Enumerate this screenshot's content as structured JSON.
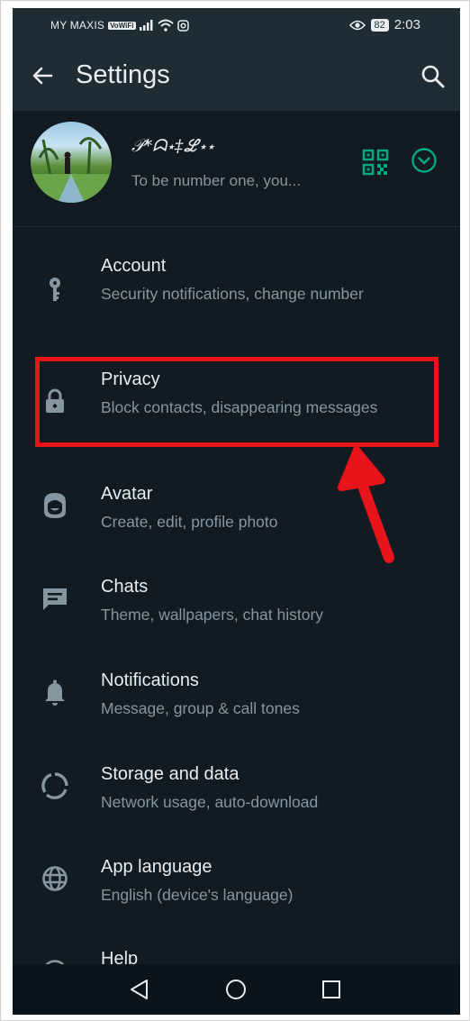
{
  "status_bar": {
    "carrier": "MY MAXIS",
    "wifi_badge": "VoWiFi",
    "battery": "82",
    "time": "2:03"
  },
  "app_bar": {
    "title": "Settings",
    "back_icon": "arrow-left-icon",
    "search_icon": "search-icon"
  },
  "profile": {
    "name": "𝒫*ᗣ⋆‡ℒ⋆⋆",
    "about": "To be number one, you...",
    "qr_icon": "qr-code-icon",
    "expand_icon": "chevron-down-circle-icon"
  },
  "settings": [
    {
      "label": "Account",
      "subtitle": "Security notifications, change number",
      "icon": "key-icon"
    },
    {
      "label": "Privacy",
      "subtitle": "Block contacts, disappearing messages",
      "icon": "lock-icon"
    },
    {
      "label": "Avatar",
      "subtitle": "Create, edit, profile photo",
      "icon": "avatar-face-icon"
    },
    {
      "label": "Chats",
      "subtitle": "Theme, wallpapers, chat history",
      "icon": "chat-icon"
    },
    {
      "label": "Notifications",
      "subtitle": "Message, group & call tones",
      "icon": "bell-icon"
    },
    {
      "label": "Storage and data",
      "subtitle": "Network usage, auto-download",
      "icon": "storage-circle-icon"
    },
    {
      "label": "App language",
      "subtitle": "English (device's language)",
      "icon": "globe-icon"
    },
    {
      "label": "Help",
      "subtitle": "",
      "icon": "help-icon"
    }
  ],
  "colors": {
    "background": "#121b22",
    "header": "#1f2c34",
    "accent": "#00a884",
    "primary_text": "#e9edef",
    "secondary_text": "#8696a0",
    "highlight": "#e8141b"
  }
}
